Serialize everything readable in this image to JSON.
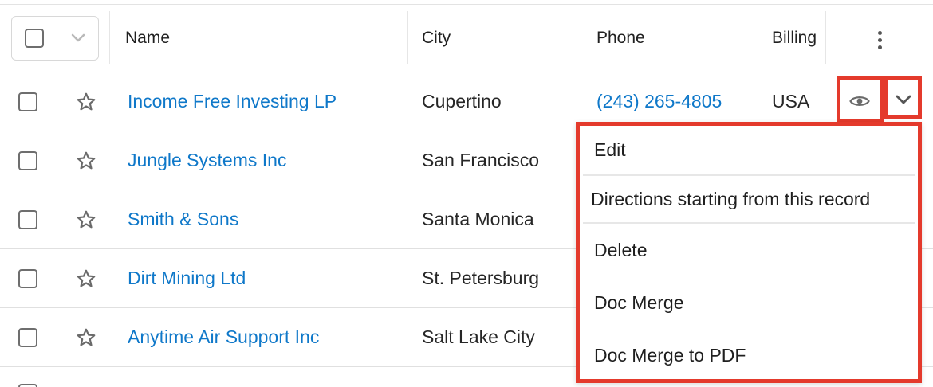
{
  "columns": {
    "name": "Name",
    "city": "City",
    "phone": "Phone",
    "billing": "Billing"
  },
  "rows": [
    {
      "name": "Income Free Investing LP",
      "city": "Cupertino",
      "phone": "(243) 265-4805",
      "billing": "USA"
    },
    {
      "name": "Jungle Systems Inc",
      "city": "San Francisco"
    },
    {
      "name": "Smith & Sons",
      "city": "Santa Monica"
    },
    {
      "name": "Dirt Mining Ltd",
      "city": "St. Petersburg"
    },
    {
      "name": "Anytime Air Support Inc",
      "city": "Salt Lake City"
    }
  ],
  "actions_menu": {
    "items": [
      "Edit",
      "Directions starting from this record",
      "Delete",
      "Doc Merge",
      "Doc Merge to PDF"
    ]
  },
  "icons": {
    "bulk_dropdown": "chevron-down-icon",
    "column_options": "vertical-ellipsis-icon",
    "favorite": "star-outline-icon",
    "preview": "eye-icon",
    "row_actions": "chevron-down-icon"
  },
  "colors": {
    "link": "#0f78c9",
    "highlight": "#e43a2c",
    "icon": "#6a6a6a"
  }
}
